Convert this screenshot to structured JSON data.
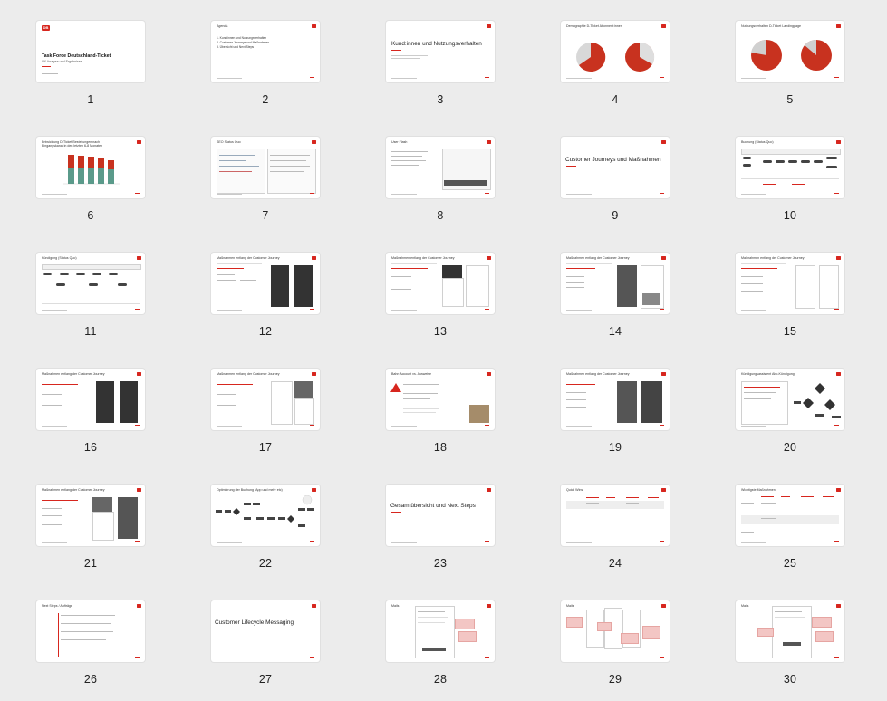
{
  "slides": [
    {
      "num": "1",
      "title": "Task Force Deutschland-Ticket",
      "subtitle": "UX Analyse und Ergebnisse",
      "logo": "DB"
    },
    {
      "num": "2",
      "title": "Agenda",
      "items": [
        "1.  Kund:innen und Nutzungsverhalten",
        "2.  Customer Journeys und Maßnahmen",
        "3.  Übersicht und Next Steps"
      ]
    },
    {
      "num": "3",
      "title": "Kund:innen und Nutzungsverhalten"
    },
    {
      "num": "4",
      "title": "Demographie D-Ticket Abonnent:innen"
    },
    {
      "num": "5",
      "title": "Nutzungsverhalten D-Ticket Landingpage"
    },
    {
      "num": "6",
      "title": "Entwicklung D-Ticket Bestellungen nach Eingangskanal in den letzten 6-8 Monaten"
    },
    {
      "num": "7",
      "title": "SEO Status Quo"
    },
    {
      "num": "8",
      "title": "User Flash"
    },
    {
      "num": "9",
      "title": "Customer Journeys und Maßnahmen"
    },
    {
      "num": "10",
      "title": "Buchung (Status Quo)"
    },
    {
      "num": "11",
      "title": "Kündigung (Status Quo)"
    },
    {
      "num": "12",
      "title": "Maßnahmen entlang der Customer Journey"
    },
    {
      "num": "13",
      "title": "Maßnahmen entlang der Customer Journey"
    },
    {
      "num": "14",
      "title": "Maßnahmen entlang der Customer Journey"
    },
    {
      "num": "15",
      "title": "Maßnahmen entlang der Customer Journey"
    },
    {
      "num": "16",
      "title": "Maßnahmen entlang der Customer Journey"
    },
    {
      "num": "17",
      "title": "Maßnahmen entlang der Customer Journey"
    },
    {
      "num": "18",
      "title": "Bahn Account vs. Ausweise"
    },
    {
      "num": "19",
      "title": "Maßnahmen entlang der Customer Journey"
    },
    {
      "num": "20",
      "title": "Kündigungsassistent Abo-Kündigung"
    },
    {
      "num": "21",
      "title": "Maßnahmen entlang der Customer Journey"
    },
    {
      "num": "22",
      "title": "Optimierung der Buchung (App und mehr etc)"
    },
    {
      "num": "23",
      "title": "Gesamtübersicht und Next Steps"
    },
    {
      "num": "24",
      "title": "Quick Wins"
    },
    {
      "num": "25",
      "title": "Wichtigste Maßnahmen"
    },
    {
      "num": "26",
      "title": "Next Steps / Aufträge"
    },
    {
      "num": "27",
      "title": "Customer Lifecycle Messaging"
    },
    {
      "num": "28",
      "title": "Mails"
    },
    {
      "num": "29",
      "title": "Mails"
    },
    {
      "num": "30",
      "title": "Mails"
    }
  ]
}
